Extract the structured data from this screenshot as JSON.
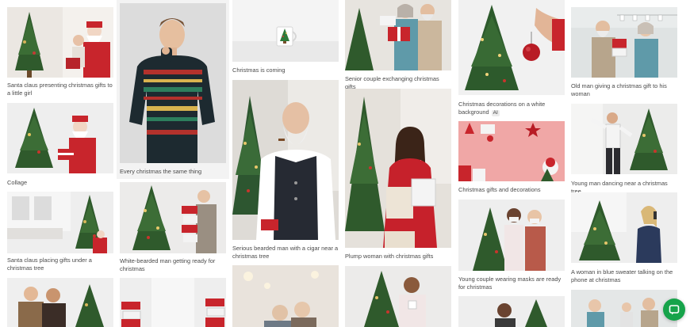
{
  "gallery": {
    "items": [
      {
        "caption": "Santa claus presenting christmas gifts to a little girl",
        "theme": "santa-gift-girl"
      },
      {
        "caption": "Collage",
        "theme": "santa-collage"
      },
      {
        "caption": "Santa claus placing gifts under a christmas tree",
        "theme": "santa-under-tree"
      },
      {
        "caption": "Every christmas the same thing",
        "theme": "man-ugly-sweater"
      },
      {
        "caption": "White-bearded man getting ready for christmas",
        "theme": "man-stacking-gifts"
      },
      {
        "caption": "Christmas is coming",
        "theme": "mug-tree"
      },
      {
        "caption": "Serious bearded man with a cigar near a christmas tree",
        "theme": "man-cigar"
      },
      {
        "caption": "Senior couple exchanging christmas gifts",
        "theme": "senior-couple"
      },
      {
        "caption": "Plump woman with christmas gifts",
        "theme": "woman-red-dress"
      },
      {
        "caption": "Christmas decorations on a white background",
        "theme": "tree-ornament",
        "badge": "AI"
      },
      {
        "caption": "Christmas gifts and decorations",
        "theme": "pink-decor"
      },
      {
        "caption": "Young couple wearing masks are ready for christmas",
        "theme": "couple-masks"
      },
      {
        "caption": "Old man giving a christmas gift to his woman",
        "theme": "old-man-gift"
      },
      {
        "caption": "Young man dancing near a christmas tree",
        "theme": "man-dancing"
      },
      {
        "caption": "A woman in blue sweater talking on the phone at christmas",
        "theme": "woman-phone"
      }
    ]
  },
  "chat": {
    "icon": "chat-bubble-icon",
    "color": "#16a34a"
  }
}
